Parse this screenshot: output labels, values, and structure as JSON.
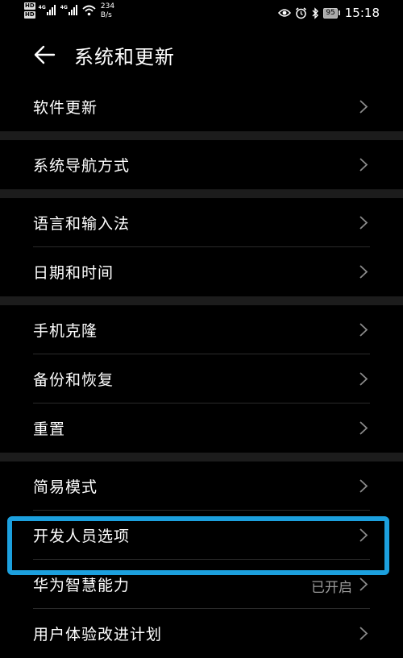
{
  "status_bar": {
    "hd_1": "HD",
    "hd_2": "HD",
    "net_1": "4G",
    "net_2": "4G",
    "speed_value": "234",
    "speed_unit": "B/s",
    "battery": "95",
    "time": "15:18"
  },
  "header": {
    "title": "系统和更新",
    "back_icon": "arrow-left-icon"
  },
  "groups": [
    {
      "items": [
        {
          "label": "软件更新"
        }
      ]
    },
    {
      "items": [
        {
          "label": "系统导航方式"
        }
      ]
    },
    {
      "items": [
        {
          "label": "语言和输入法"
        },
        {
          "label": "日期和时间"
        }
      ]
    },
    {
      "items": [
        {
          "label": "手机克隆"
        },
        {
          "label": "备份和恢复"
        },
        {
          "label": "重置"
        }
      ]
    },
    {
      "items": [
        {
          "label": "简易模式"
        },
        {
          "label": "开发人员选项"
        },
        {
          "label": "华为智慧能力",
          "value": "已开启"
        },
        {
          "label": "用户体验改进计划"
        }
      ]
    }
  ],
  "colors": {
    "highlight": "#1ca0de",
    "separator": "#1c1c1c",
    "value_text": "#9a9a9a"
  }
}
